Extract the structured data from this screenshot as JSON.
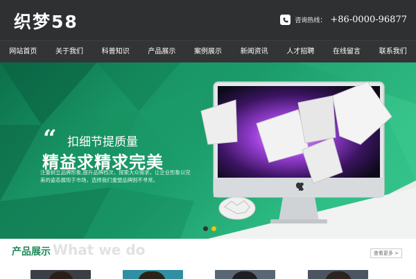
{
  "header": {
    "logo": "织梦58",
    "hotline_label": "咨询热线：",
    "hotline_number": "+86-0000-96877"
  },
  "nav": {
    "items": [
      "网站首页",
      "关于我们",
      "科普知识",
      "产品展示",
      "案例展示",
      "新闻资讯",
      "人才招聘",
      "在线留言",
      "联系我们"
    ]
  },
  "hero": {
    "quote_mark": "“",
    "line1": "扣细节提质量",
    "line2": "精益求精求完美",
    "desc": "注重树立品牌形象,提升品牌档次，探索大众需求，让企业形象以完美的姿态展现于市场，选择我们重塑品牌则不寻常。",
    "dots": 2,
    "active_dot": 1
  },
  "products": {
    "title": "产品展示",
    "subtitle": "What we do",
    "more": "查看更多 >"
  }
}
